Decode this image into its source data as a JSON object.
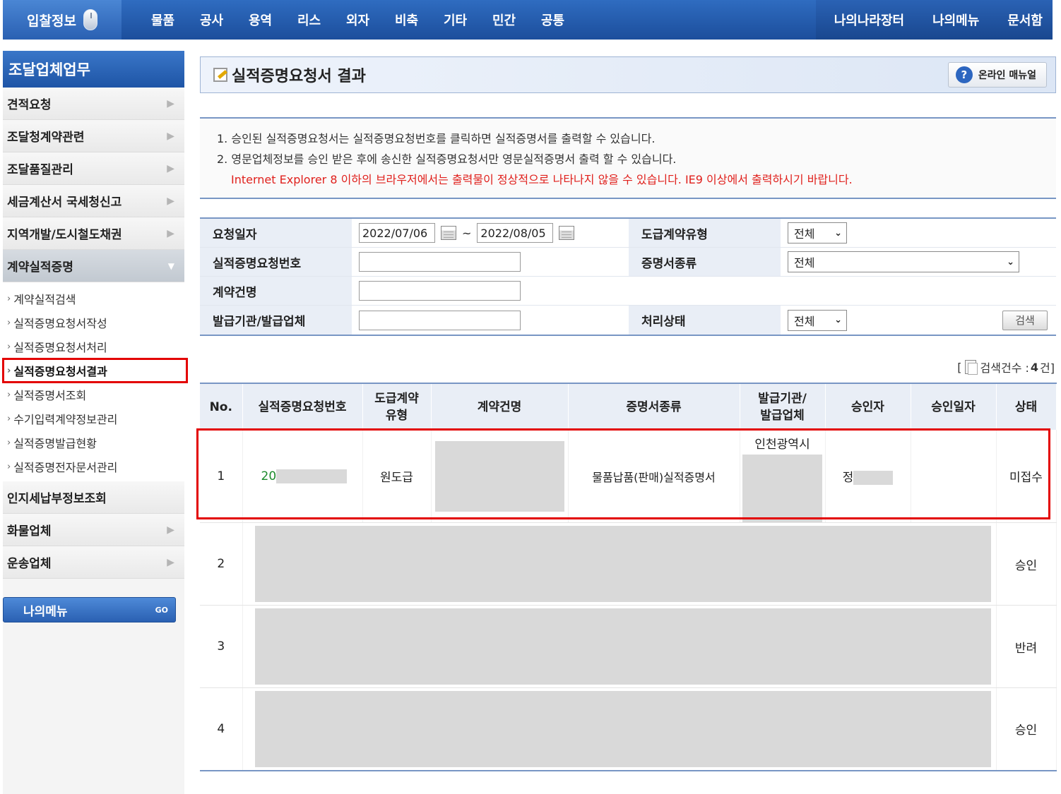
{
  "topnav": {
    "brand": "입찰정보",
    "menu": [
      "물품",
      "공사",
      "용역",
      "리스",
      "외자",
      "비축",
      "기타",
      "민간",
      "공통"
    ],
    "right": [
      "나의나라장터",
      "나의메뉴",
      "문서함"
    ],
    "color": "#2f6cc0"
  },
  "sidebar": {
    "title": "조달업체업무",
    "items_top": [
      "견적요청",
      "조달청계약관련",
      "조달품질관리",
      "세금계산서 국세청신고",
      "지역개발/도시철도채권"
    ],
    "open_item": "계약실적증명",
    "sub_items": [
      "계약실적검색",
      "실적증명요청서작성",
      "실적증명요청서처리",
      "실적증명요청서결과",
      "실적증명서조회",
      "수기입력계약정보관리",
      "실적증명발급현황",
      "실적증명전자문서관리"
    ],
    "active_sub": "실적증명요청서결과",
    "items_bottom": [
      "인지세납부정보조회",
      "화물업체",
      "운송업체"
    ],
    "mymenu": "나의메뉴",
    "mymenu_go": "GO"
  },
  "page": {
    "title": "실적증명요청서 결과",
    "manual_btn": "온라인 매뉴얼"
  },
  "notice": {
    "line1": "1. 승인된 실적증명요청서는 실적증명요청번호를 클릭하면 실적증명서를 출력할 수 있습니다.",
    "line2": "2. 영문업체정보를 승인 받은 후에 송신한 실적증명요청서만 영문실적증명서 출력 할 수 있습니다.",
    "warn": "Internet Explorer 8 이하의 브라우저에서는 출력물이 정상적으로 나타나지 않을 수 있습니다. IE9 이상에서 출력하시기 바랍니다."
  },
  "search": {
    "req_date_label": "요청일자",
    "date_from": "2022/07/06",
    "date_sep": "~",
    "date_to": "2022/08/05",
    "contract_type_label": "도급계약유형",
    "contract_type_value": "전체",
    "req_no_label": "실적증명요청번호",
    "req_no_value": "",
    "cert_kind_label": "증명서종류",
    "cert_kind_value": "전체",
    "contract_name_label": "계약건명",
    "contract_name_value": "",
    "issuer_label": "발급기관/발급업체",
    "issuer_value": "",
    "status_label": "처리상태",
    "status_value": "전체",
    "search_btn": "검색"
  },
  "result": {
    "count_prefix": "[",
    "count_label": "검색건수 : ",
    "count_value": "4",
    "count_suffix": " 건]",
    "headers": [
      "No.",
      "실적증명요청번호",
      "도급계약 유형",
      "계약건명",
      "증명서종류",
      "발급기관/ 발급업체",
      "승인자",
      "승인일자",
      "상태"
    ],
    "rows": [
      {
        "no": "1",
        "req_no": "20",
        "type": "원도급",
        "contract": "",
        "cert": "물품납품(판매)실적증명서",
        "issuer": "인천광역시",
        "approver": "정",
        "date": "",
        "status": "미접수",
        "status_color": "#e0201c"
      },
      {
        "no": "2",
        "status": "승인",
        "status_color": "#1f3fbf"
      },
      {
        "no": "3",
        "status": "반려",
        "status_color": "#e0201c"
      },
      {
        "no": "4",
        "status": "승인",
        "status_color": "#1f3fbf"
      }
    ]
  }
}
